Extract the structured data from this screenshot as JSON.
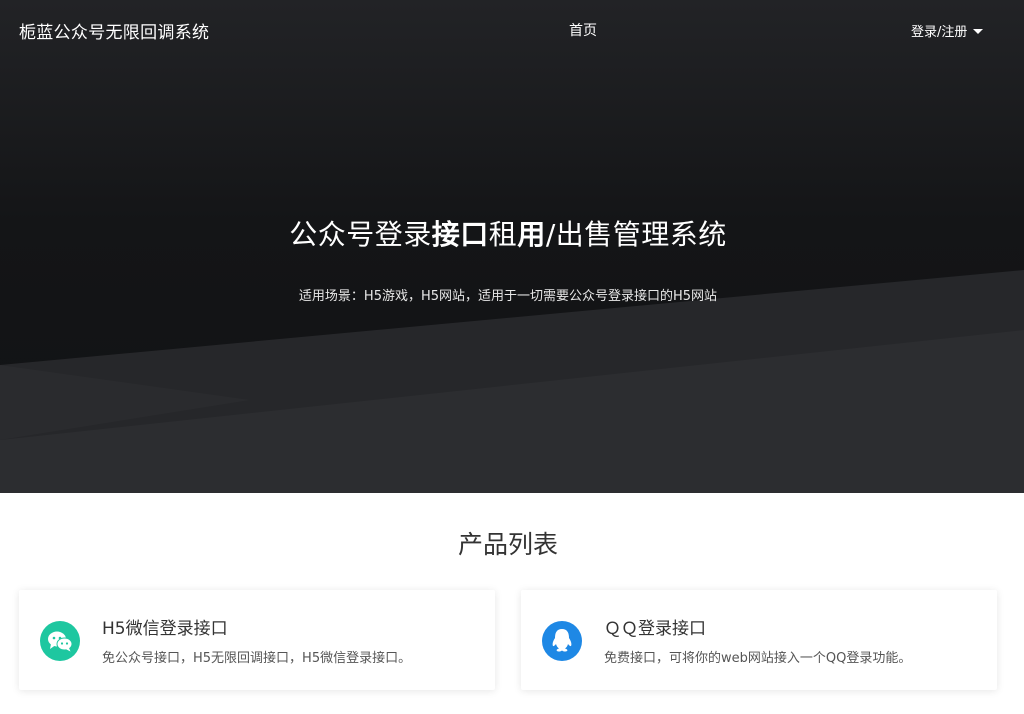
{
  "navbar": {
    "brand": "栀蓝公众号无限回调系统",
    "home_label": "首页",
    "login_label": "登录/注册"
  },
  "hero": {
    "title_part1": "公众号登录",
    "title_bold1": "接口",
    "title_part2": "租",
    "title_bold2": "用",
    "title_part3": "/出售管理系统",
    "subtitle": "适用场景：H5游戏，H5网站，适用于一切需要公众号登录接口的H5网站"
  },
  "products": {
    "section_title": "产品列表",
    "items": [
      {
        "icon": "wechat-icon",
        "icon_color": "#1ec7a0",
        "title": "H5微信登录接口",
        "description": "免公众号接口，H5无限回调接口，H5微信登录接口。"
      },
      {
        "icon": "qq-icon",
        "icon_color": "#1e88e5",
        "title": "ＱＱ登录接口",
        "description": "免费接口，可将你的web网站接入一个QQ登录功能。"
      }
    ]
  }
}
